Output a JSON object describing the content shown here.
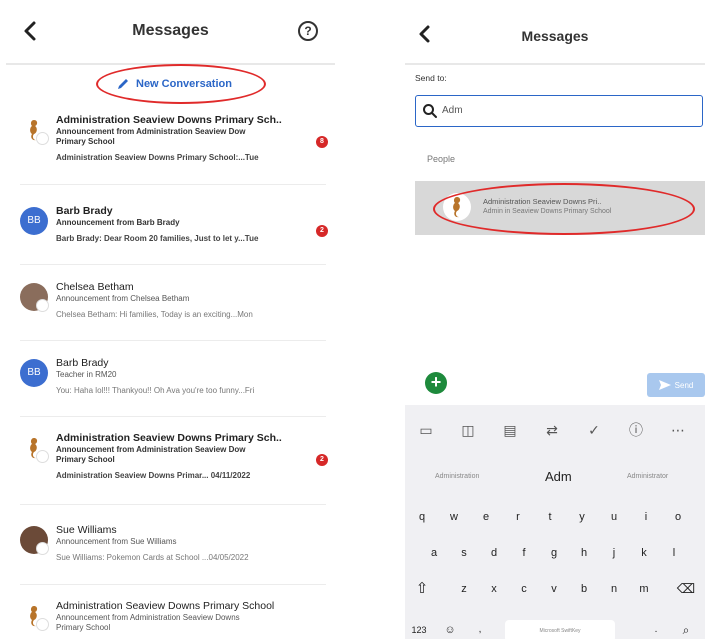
{
  "left": {
    "header": {
      "title": "Messages",
      "help_symbol": "?"
    },
    "new_conversation_label": "New Conversation",
    "conversations": [
      {
        "avatar": "seahorse-icon",
        "name": "Administration Seaview Downs Primary Sch..",
        "subtitle_line1": "Announcement from Administration Seaview Dow",
        "subtitle_line2": "Primary School",
        "preview": "Administration Seaview Downs Primary School:...Tue",
        "badge": "8",
        "unread": true
      },
      {
        "avatar": "BB",
        "name": "Barb Brady",
        "subtitle_line1": "Announcement from Barb Brady",
        "subtitle_line2": "",
        "preview": "Barb Brady: Dear Room 20 families, Just to let y...Tue",
        "badge": "2",
        "unread": true
      },
      {
        "avatar": "photo",
        "name": "Chelsea Betham",
        "subtitle_line1": "Announcement from Chelsea Betham",
        "subtitle_line2": "",
        "preview": "Chelsea Betham: Hi families, Today is an exciting...Mon",
        "badge": "",
        "unread": false
      },
      {
        "avatar": "BB",
        "name": "Barb Brady",
        "subtitle_line1": "Teacher in RM20",
        "subtitle_line2": "",
        "preview": "You: Haha lol!!! Thankyou!! Oh Ava you're too funny...Fri",
        "badge": "",
        "unread": false
      },
      {
        "avatar": "seahorse-icon",
        "name": "Administration Seaview Downs Primary Sch..",
        "subtitle_line1": "Announcement from Administration Seaview Dow",
        "subtitle_line2": "Primary School",
        "preview": "Administration Seaview Downs Primar... 04/11/2022",
        "badge": "2",
        "unread": true
      },
      {
        "avatar": "photo",
        "name": "Sue Williams",
        "subtitle_line1": "Announcement from Sue Williams",
        "subtitle_line2": "",
        "preview": "Sue Williams: Pokemon Cards at School ...04/05/2022",
        "badge": "",
        "unread": false
      },
      {
        "avatar": "seahorse-icon",
        "name": "Administration Seaview Downs Primary School",
        "subtitle_line1": "Announcement from Administration Seaview Downs",
        "subtitle_line2": "Primary School",
        "preview": "",
        "badge": "",
        "unread": false
      }
    ]
  },
  "right": {
    "header": {
      "title": "Messages"
    },
    "send_to_label": "Send to:",
    "search": {
      "value": "Adm"
    },
    "people_label": "People",
    "suggestion": {
      "name": "Administration Seaview Downs Pri..",
      "role": "Admin in Seaview Downs Primary School"
    },
    "send_label": "Send",
    "add_symbol": "+",
    "keyboard": {
      "suggestions": [
        "Administration",
        "Adm",
        "Administrator"
      ],
      "row1": [
        "q",
        "w",
        "e",
        "r",
        "t",
        "y",
        "u",
        "i",
        "o"
      ],
      "row2": [
        "a",
        "s",
        "d",
        "f",
        "g",
        "h",
        "j",
        "k",
        "l"
      ],
      "row3": [
        "z",
        "x",
        "c",
        "v",
        "b",
        "n",
        "m"
      ],
      "numbers_key": "123",
      "space_label": "Microsoft SwiftKey"
    }
  },
  "colors": {
    "accent_blue": "#2b66c7",
    "badge_red": "#d62828",
    "annotation_red": "#e02a2a",
    "add_green": "#1e8a3c"
  }
}
